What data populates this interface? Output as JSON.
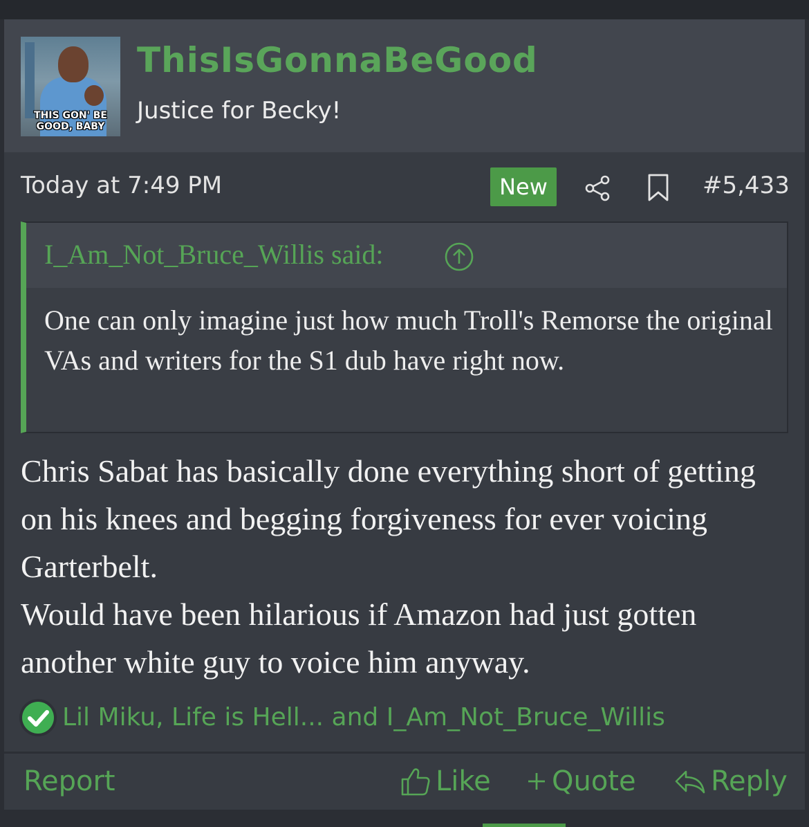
{
  "post": {
    "username": "ThisIsGonnaBeGood",
    "user_title": "Justice for Becky!",
    "avatar_caption": "THIS GON' BE GOOD, BABY",
    "timestamp": "Today at 7:49 PM",
    "new_badge": "New",
    "post_number": "#5,433",
    "quote": {
      "author_line": "I_Am_Not_Bruce_Willis said:",
      "text": "One can only imagine just how much Troll's Remorse the original VAs and writers for the S1 dub have right now."
    },
    "message": {
      "paragraph_1": "Chris Sabat has basically done everything short of getting on his knees and begging forgiveness for ever voicing Garterbelt.",
      "paragraph_2": "Would have been hilarious if Amazon had just gotten another white guy to voice him anyway."
    },
    "reactions_text": "Lil Miku, Life is Hell... and I_Am_Not_Bruce_Willis",
    "actions": {
      "report": "Report",
      "like": "Like",
      "quote": "Quote",
      "reply": "Reply"
    }
  },
  "icons": [
    "share-icon",
    "bookmark-icon",
    "arrow-up-circle-icon",
    "checkmark-reaction-icon",
    "thumbs-up-icon",
    "plus-icon",
    "reply-arrow-icon"
  ],
  "colors": {
    "accent_green": "#56a556",
    "badge_green": "#4c9a48",
    "background": "#373b42",
    "header_background": "#42464e"
  }
}
